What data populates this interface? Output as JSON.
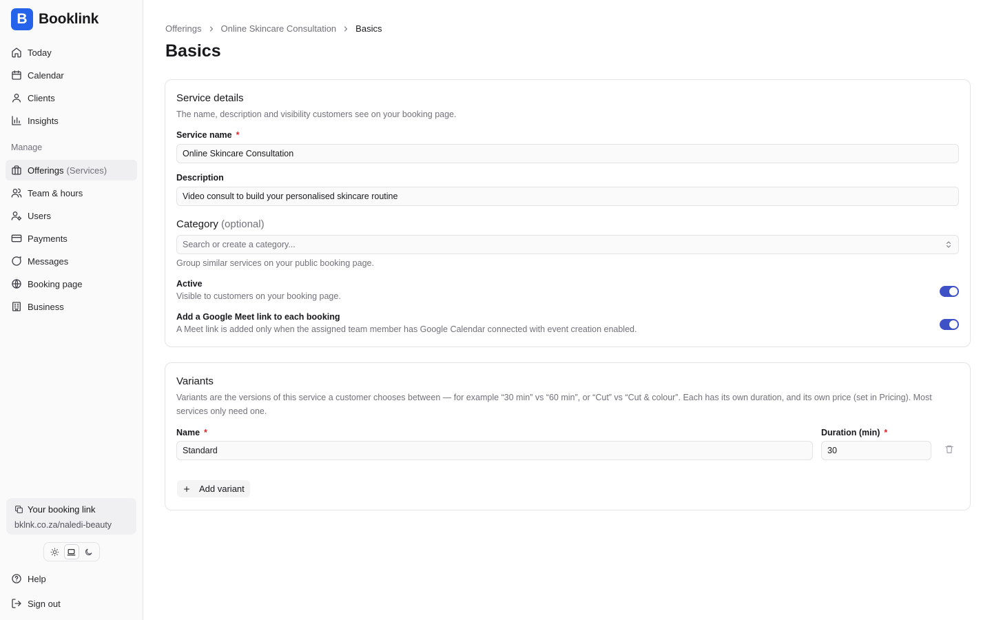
{
  "app": {
    "name": "Booklink",
    "logo_letter": "B",
    "brand_color": "#2563eb"
  },
  "sidebar": {
    "primary": [
      {
        "label": "Today",
        "icon": "home-icon"
      },
      {
        "label": "Calendar",
        "icon": "calendar-icon"
      },
      {
        "label": "Clients",
        "icon": "user-icon"
      },
      {
        "label": "Insights",
        "icon": "chart-icon"
      }
    ],
    "section_label": "Manage",
    "manage": [
      {
        "label": "Offerings",
        "suffix": "(Services)",
        "icon": "gift-icon",
        "active": true
      },
      {
        "label": "Team & hours",
        "icon": "users-icon"
      },
      {
        "label": "Users",
        "icon": "user-cog-icon"
      },
      {
        "label": "Payments",
        "icon": "credit-card-icon"
      },
      {
        "label": "Messages",
        "icon": "message-icon"
      },
      {
        "label": "Booking page",
        "icon": "globe-icon"
      },
      {
        "label": "Business",
        "icon": "building-icon"
      }
    ],
    "booking_link": {
      "title": "Your booking link",
      "url": "bklnk.co.za/naledi-beauty"
    },
    "theme": {
      "options": [
        "light",
        "system",
        "dark"
      ],
      "selected": "system"
    },
    "footer": [
      {
        "label": "Help",
        "icon": "help-icon"
      },
      {
        "label": "Sign out",
        "icon": "sign-out-icon"
      }
    ]
  },
  "breadcrumb": [
    "Offerings",
    "Online Skincare Consultation",
    "Basics"
  ],
  "page_title": "Basics",
  "service_details": {
    "title": "Service details",
    "description": "The name, description and visibility customers see on your booking page.",
    "service_name_label": "Service name",
    "required_mark": "*",
    "service_name_value": "Online Skincare Consultation",
    "description_label": "Description",
    "description_value": "Video consult to build your personalised skincare routine",
    "category_label": "Category",
    "category_optional": "(optional)",
    "category_placeholder": "Search or create a category...",
    "category_hint": "Group similar services on your public booking page.",
    "active_label": "Active",
    "active_hint": "Visible to customers on your booking page.",
    "active_on": true,
    "meet_label": "Add a Google Meet link to each booking",
    "meet_hint": "A Meet link is added only when the assigned team member has Google Calendar connected with event creation enabled.",
    "meet_on": true,
    "toggle_color": "#3f51c7"
  },
  "variants": {
    "title": "Variants",
    "description": "Variants are the versions of this service a customer chooses between — for example “30 min” vs “60 min”, or “Cut” vs “Cut & colour”. Each has its own duration, and its own price (set in Pricing). Most services only need one.",
    "name_label": "Name",
    "duration_label": "Duration (min)",
    "required_mark": "*",
    "rows": [
      {
        "name": "Standard",
        "duration": "30"
      }
    ],
    "add_label": "Add variant"
  }
}
